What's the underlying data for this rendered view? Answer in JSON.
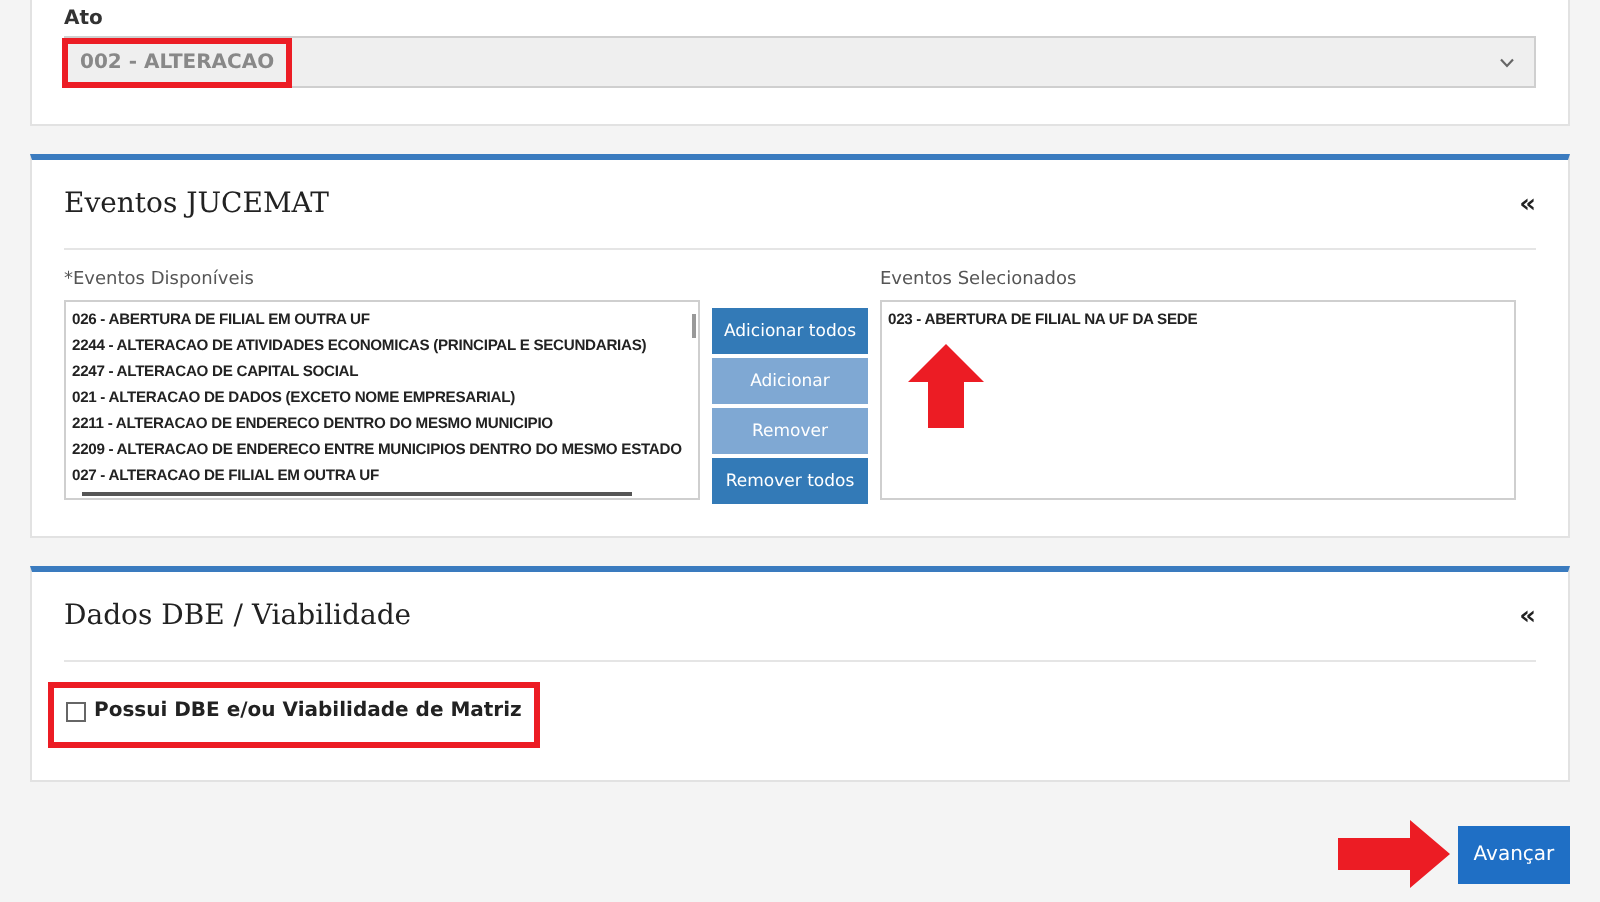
{
  "ato": {
    "label": "Ato",
    "value": "002 - ALTERACAO",
    "highlighted": true
  },
  "eventos": {
    "title": "Eventos JUCEMAT",
    "collapse": "«",
    "available_label": "*Eventos Disponíveis",
    "available": [
      "026 - ABERTURA DE FILIAL EM OUTRA UF",
      "2244 - ALTERACAO DE ATIVIDADES ECONOMICAS (PRINCIPAL E SECUNDARIAS)",
      "2247 - ALTERACAO DE CAPITAL SOCIAL",
      "021 - ALTERACAO DE DADOS (EXCETO NOME EMPRESARIAL)",
      "2211 - ALTERACAO DE ENDERECO DENTRO DO MESMO MUNICIPIO",
      "2209 - ALTERACAO DE ENDERECO ENTRE MUNICIPIOS DENTRO DO MESMO ESTADO",
      "027 - ALTERACAO DE FILIAL EM OUTRA UF"
    ],
    "buttons": [
      {
        "label": "Adicionar todos",
        "disabled": false
      },
      {
        "label": "Adicionar",
        "disabled": true
      },
      {
        "label": "Remover",
        "disabled": true
      },
      {
        "label": "Remover todos",
        "disabled": false
      }
    ],
    "selected_label": "Eventos Selecionados",
    "selected": [
      "023 - ABERTURA DE FILIAL NA UF DA SEDE"
    ],
    "pointer_arrow": true
  },
  "dbe": {
    "title": "Dados DBE / Viabilidade",
    "collapse": "«",
    "checkbox": {
      "label": "Possui DBE e/ou Viabilidade de Matriz",
      "checked": false,
      "highlighted": true
    }
  },
  "next_button": {
    "label": "Avançar",
    "pointer_arrow": true
  }
}
